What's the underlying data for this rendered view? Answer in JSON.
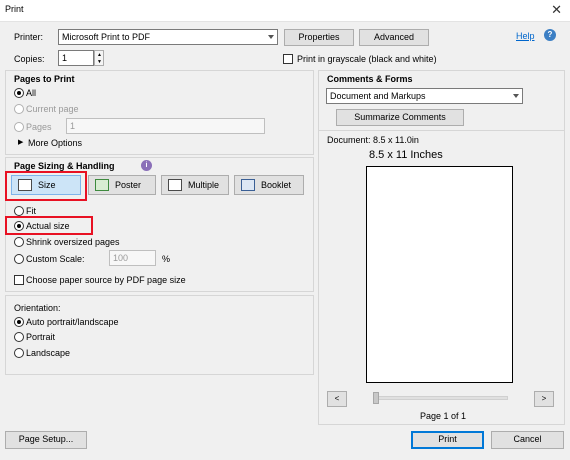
{
  "window": {
    "title": "Print",
    "close_glyph": "✕"
  },
  "printer": {
    "label": "Printer:",
    "selected": "Microsoft Print to PDF",
    "properties_label": "Properties",
    "advanced_label": "Advanced",
    "help_label": "Help",
    "help_icon_glyph": "?"
  },
  "copies": {
    "label": "Copies:",
    "value": "1",
    "grayscale_label": "Print in grayscale (black and white)",
    "grayscale_checked": false
  },
  "pages_to_print": {
    "title": "Pages to Print",
    "all_label": "All",
    "current_page_label": "Current page",
    "pages_label": "Pages",
    "pages_value": "1",
    "more_options_label": "More Options"
  },
  "sizing": {
    "title": "Page Sizing & Handling",
    "info_glyph": "i",
    "buttons": [
      "Size",
      "Poster",
      "Multiple",
      "Booklet"
    ],
    "fit_label": "Fit",
    "actual_size_label": "Actual size",
    "shrink_label": "Shrink oversized pages",
    "custom_scale_label": "Custom Scale:",
    "custom_scale_value": "100",
    "percent_label": "%",
    "paper_source_label": "Choose paper source by PDF page size"
  },
  "orientation": {
    "title": "Orientation:",
    "auto_label": "Auto portrait/landscape",
    "portrait_label": "Portrait",
    "landscape_label": "Landscape"
  },
  "comments_forms": {
    "title": "Comments & Forms",
    "selected": "Document and Markups",
    "summarize_label": "Summarize Comments"
  },
  "preview": {
    "document_label": "Document: 8.5 x 11.0in",
    "page_size_label": "8.5 x 11 Inches",
    "page_indicator": "Page 1 of 1",
    "prev_glyph": "<",
    "next_glyph": ">"
  },
  "footer": {
    "page_setup_label": "Page Setup...",
    "print_label": "Print",
    "cancel_label": "Cancel"
  },
  "colors": {
    "accent": "#0078d7",
    "highlight_border": "#e81123",
    "link": "#0066cc"
  }
}
